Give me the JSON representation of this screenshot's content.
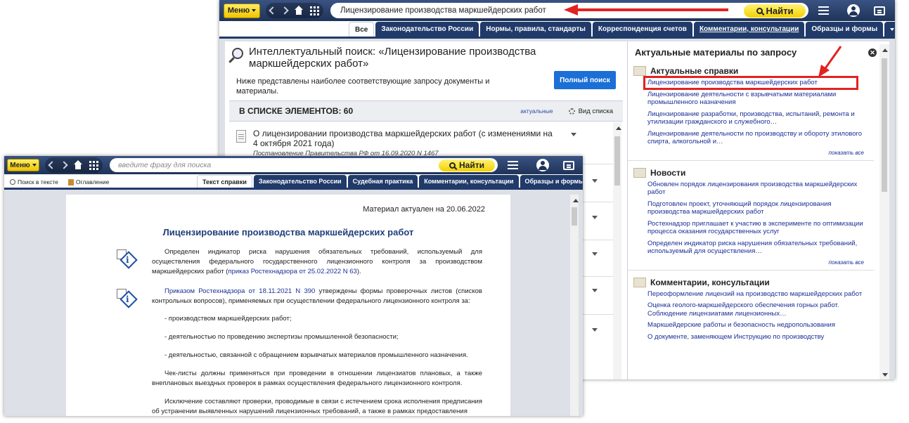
{
  "w1": {
    "toolbar": {
      "menu_label": "Меню",
      "search_value": "Лицензирование производства маркшейдерских работ",
      "find_label": "Найти"
    },
    "tabs": [
      "Все",
      "Законодательство России",
      "Нормы, правила, стандарты",
      "Корреспонденция счетов",
      "Комментарии, консультации",
      "Образцы и формы"
    ],
    "search_title": "Интеллектуальный поиск: «Лицензирование производства маркшейдерских работ»",
    "description": "Ниже представлены наиболее соответствующие запросу документы и материалы.",
    "full_search_label": "Полный поиск",
    "count_label": "В СПИСКЕ ЭЛЕМЕНТОВ: 60",
    "actual_label": "актуальные",
    "view_label": "Вид списка",
    "result": {
      "title": "О лицензировании производства маркшейдерских работ (с изменениями на 4 октября 2021 года)",
      "subtitle": "Постановление Правительства РФ от 16.09.2020 N 1467"
    },
    "right_panel": {
      "title": "Актуальные материалы по запросу",
      "show_all": "показать все",
      "sections": [
        {
          "heading": "Актуальные справки",
          "items": [
            "Лицензирование производства маркшейдерских работ",
            "Лицензирование деятельности с взрывчатыми материалами промышленного назначения",
            "Лицензирование разработки, производства, испытаний, ремонта и утилизации гражданского и служебного…",
            "Лицензирование деятельности по производству и обороту этилового спирта, алкогольной и…"
          ]
        },
        {
          "heading": "Новости",
          "items": [
            "Обновлен порядок лицензирования производства маркшейдерских работ",
            "Подготовлен проект, уточняющий порядок лицензирования производства маркшейдерских работ",
            "Ростехнадзор приглашает к участию в эксперименте по оптимизации процесса оказания государственных услуг",
            "Определен индикатор риска нарушения обязательных требований, используемый для осуществления…"
          ]
        },
        {
          "heading": "Комментарии, консультации",
          "items": [
            "Переоформление лицензий на производство маркшейдерских работ",
            "Оценка геолого-маркшейдерского обеспечения горных работ. Соблюдение лицензиатами лицензионных…",
            "Маркшейдерские работы и безопасность недропользования",
            "О документе, заменяющем Инструкцию по производству"
          ]
        }
      ]
    }
  },
  "w2": {
    "toolbar": {
      "menu_label": "Меню",
      "search_placeholder": "введите фразу для поиска",
      "find_label": "Найти"
    },
    "tools": [
      "Поиск в тексте",
      "Оглавление"
    ],
    "tabs": [
      "Текст справки",
      "Законодательство России",
      "Судебная практика",
      "Комментарии, консультации",
      "Образцы и формы"
    ],
    "doc": {
      "actual": "Материал актуален на 20.06.2022",
      "title": "Лицензирование производства маркшейдерских работ",
      "p1_text": "Определен индикатор риска нарушения обязательных требований, используемый для осуществления федерального государственного лицензионного контроля за производством маркшейдерских работ (",
      "p1_link": "приказ Ростехнадзора от 25.02.2022 N 63",
      "p1_end": ").",
      "p2_link": "Приказом Ростехнадзора от 18.11.2021 N 390",
      "p2_text": " утверждены формы проверочных листов (списков контрольных вопросов), применяемых при осуществлении федерального лицензионного контроля за:",
      "b1": "- производством маркшейдерских работ;",
      "b2": "- деятельностью по проведению экспертизы промышленной безопасности;",
      "b3": "- деятельностью, связанной с обращением взрывчатых материалов промышленного назначения.",
      "p3": "Чек-листы должны применяться при проведении в отношении лицензиатов плановых, а также внеплановых выездных проверок в рамках осуществления федерального лицензионного контроля.",
      "p4": "Исключение составляют проверки, проводимые в связи с истечением срока исполнения предписания об устранении выявленных нарушений лицензионных требований, а также в рамках предоставления"
    }
  },
  "colors": {
    "toolbar": "#1f3358",
    "tab": "#203a6a",
    "link": "#1a2f96",
    "highlight": "#e32222",
    "find": "#f3d100"
  }
}
